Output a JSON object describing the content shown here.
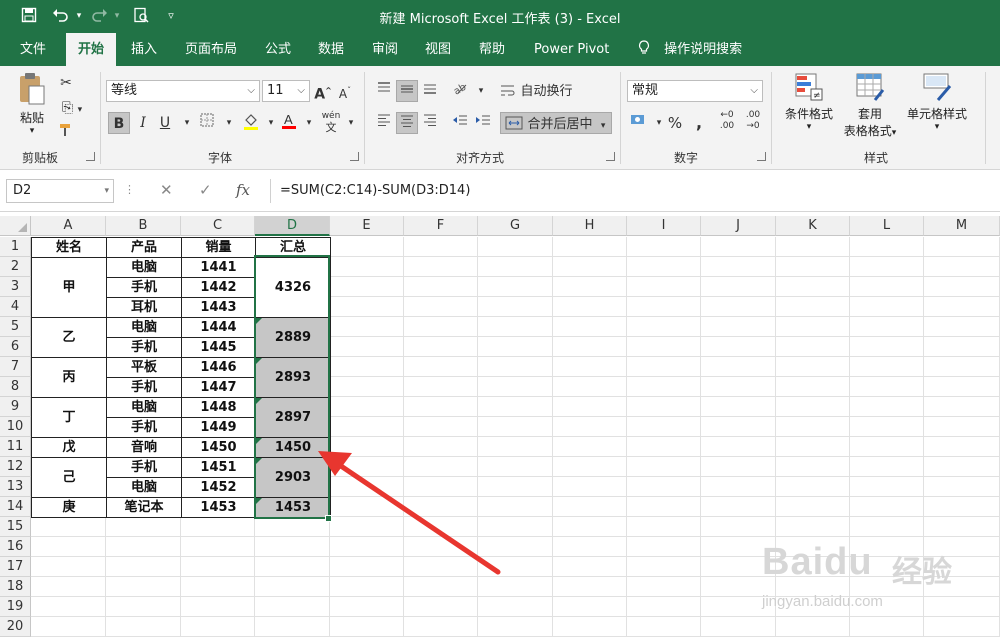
{
  "title_bar": {
    "title": "新建 Microsoft Excel 工作表 (3)  -  Excel",
    "quick_access": [
      "save-icon",
      "undo-icon",
      "redo-icon",
      "print-preview-icon",
      "customize-icon"
    ]
  },
  "tabs": [
    "文件",
    "开始",
    "插入",
    "页面布局",
    "公式",
    "数据",
    "审阅",
    "视图",
    "帮助",
    "Power Pivot",
    "操作说明搜索"
  ],
  "active_tab": "开始",
  "ribbon": {
    "clipboard": {
      "paste": "粘贴",
      "label": "剪贴板"
    },
    "font": {
      "name": "等线",
      "size": "11",
      "label": "字体",
      "bold": "B",
      "italic": "I",
      "underline": "U",
      "grow": "A",
      "shrink": "A",
      "wen": "wén"
    },
    "alignment": {
      "wrap": "自动换行",
      "merge": "合并后居中",
      "label": "对齐方式"
    },
    "number": {
      "format": "常规",
      "label": "数字",
      "percent": "%",
      "comma": ","
    },
    "styles": {
      "conditional": "条件格式",
      "table_top": "套用",
      "table_bottom": "表格格式",
      "cell_style": "单元格样式",
      "label": "样式"
    }
  },
  "formula_bar": {
    "name_box": "D2",
    "cancel": "✕",
    "enter": "✓",
    "fx": "fx",
    "formula": "=SUM(C2:C14)-SUM(D3:D14)"
  },
  "columns": [
    "A",
    "B",
    "C",
    "D",
    "E",
    "F",
    "G",
    "H",
    "I",
    "J",
    "K",
    "L",
    "M"
  ],
  "rows": [
    "1",
    "2",
    "3",
    "4",
    "5",
    "6",
    "7",
    "8",
    "9",
    "10",
    "11",
    "12",
    "13",
    "14",
    "15",
    "16",
    "17",
    "18",
    "19",
    "20"
  ],
  "table": {
    "headers": [
      "姓名",
      "产品",
      "销量",
      "汇总"
    ],
    "names": [
      "甲",
      "乙",
      "丙",
      "丁",
      "戊",
      "己",
      "庚"
    ],
    "products": [
      "电脑",
      "手机",
      "耳机",
      "电脑",
      "手机",
      "平板",
      "手机",
      "电脑",
      "手机",
      "音响",
      "手机",
      "电脑",
      "笔记本"
    ],
    "sales": [
      "1441",
      "1442",
      "1443",
      "1444",
      "1445",
      "1446",
      "1447",
      "1448",
      "1449",
      "1450",
      "1451",
      "1452",
      "1453"
    ],
    "totals": [
      "4326",
      "2889",
      "2893",
      "2897",
      "1450",
      "2903",
      "1453"
    ]
  },
  "selected_cell": "D2",
  "watermark": {
    "logo": "Baidu",
    "cn": "经验",
    "url": "jingyan.baidu.com"
  },
  "colors": {
    "accent": "#217346",
    "arrow": "#e8362f",
    "merged_fill": "#c6c6c6"
  }
}
